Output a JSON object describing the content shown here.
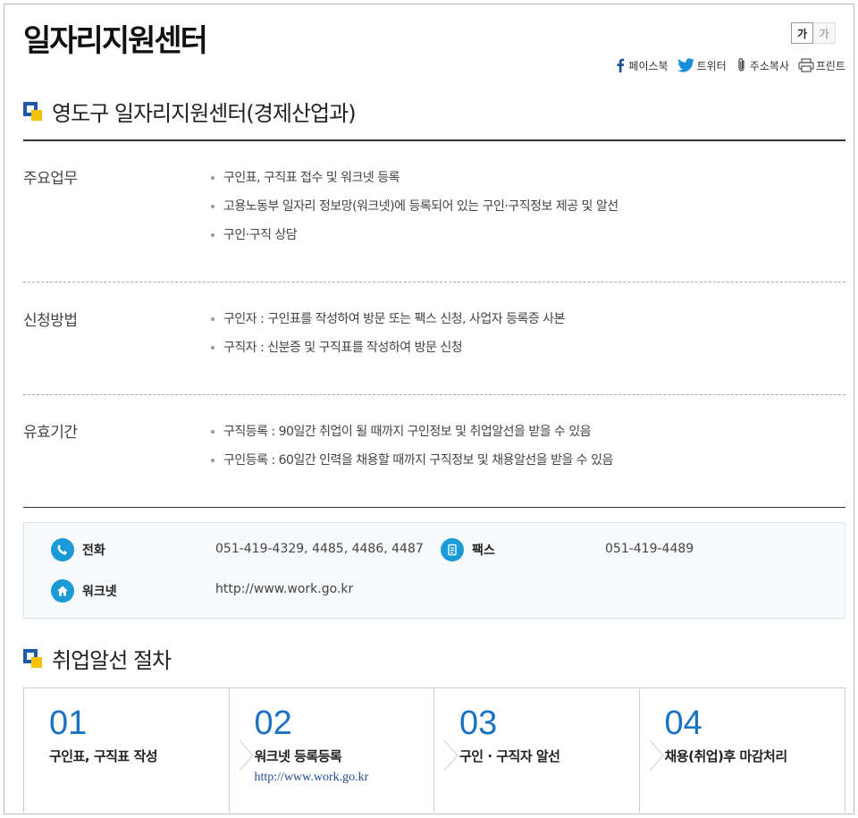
{
  "page_title": "일자리지원센터",
  "font_controls": {
    "larger": "가",
    "smaller": "가"
  },
  "share": {
    "facebook": "페이스북",
    "twitter": "트위터",
    "copy_url": "주소복사",
    "print": "프린트"
  },
  "section1": {
    "title": "영도구 일자리지원센터(경제산업과)",
    "rows": [
      {
        "label": "주요업무",
        "items": [
          "구인표, 구직표 접수 및 워크넷 등록",
          "고용노동부 일자리 정보망(워크넷)에 등록되어 있는 구인·구직정보 제공 및 알선",
          "구인·구직 상담"
        ]
      },
      {
        "label": "신청방법",
        "items": [
          "구인자 : 구인표를 작성하여 방문 또는 팩스 신청, 사업자 등록증 사본",
          "구직자 : 신분증 및 구직표를 작성하여 방문 신청"
        ]
      },
      {
        "label": "유효기간",
        "items": [
          "구직등록 : 90일간 취업이 될 때까지 구인정보 및 취업알선을 받을 수 있음",
          "구인등록 : 60일간 인력을 채용할 때까지 구직정보 및 채용알선을 받을 수 있음"
        ]
      }
    ]
  },
  "contact": {
    "phone_label": "전화",
    "phone_value": "051-419-4329, 4485, 4486, 4487",
    "fax_label": "팩스",
    "fax_value": "051-419-4489",
    "worknet_label": "워크넷",
    "worknet_value": "http://www.work.go.kr"
  },
  "section2": {
    "title": "취업알선 절차",
    "steps": [
      {
        "num": "01",
        "title": "구인표, 구직표 작성"
      },
      {
        "num": "02",
        "title": "워크넷 등록등록",
        "link": "http://www.work.go.kr"
      },
      {
        "num": "03",
        "title": "구인 · 구직자 알선"
      },
      {
        "num": "04",
        "title": "채용(취업)후 마감처리"
      }
    ]
  },
  "colors": {
    "accent_blue": "#1e5aa8",
    "accent_yellow": "#f6c300",
    "icon_blue": "#1a9bd7",
    "step_num": "#1a73c0"
  }
}
